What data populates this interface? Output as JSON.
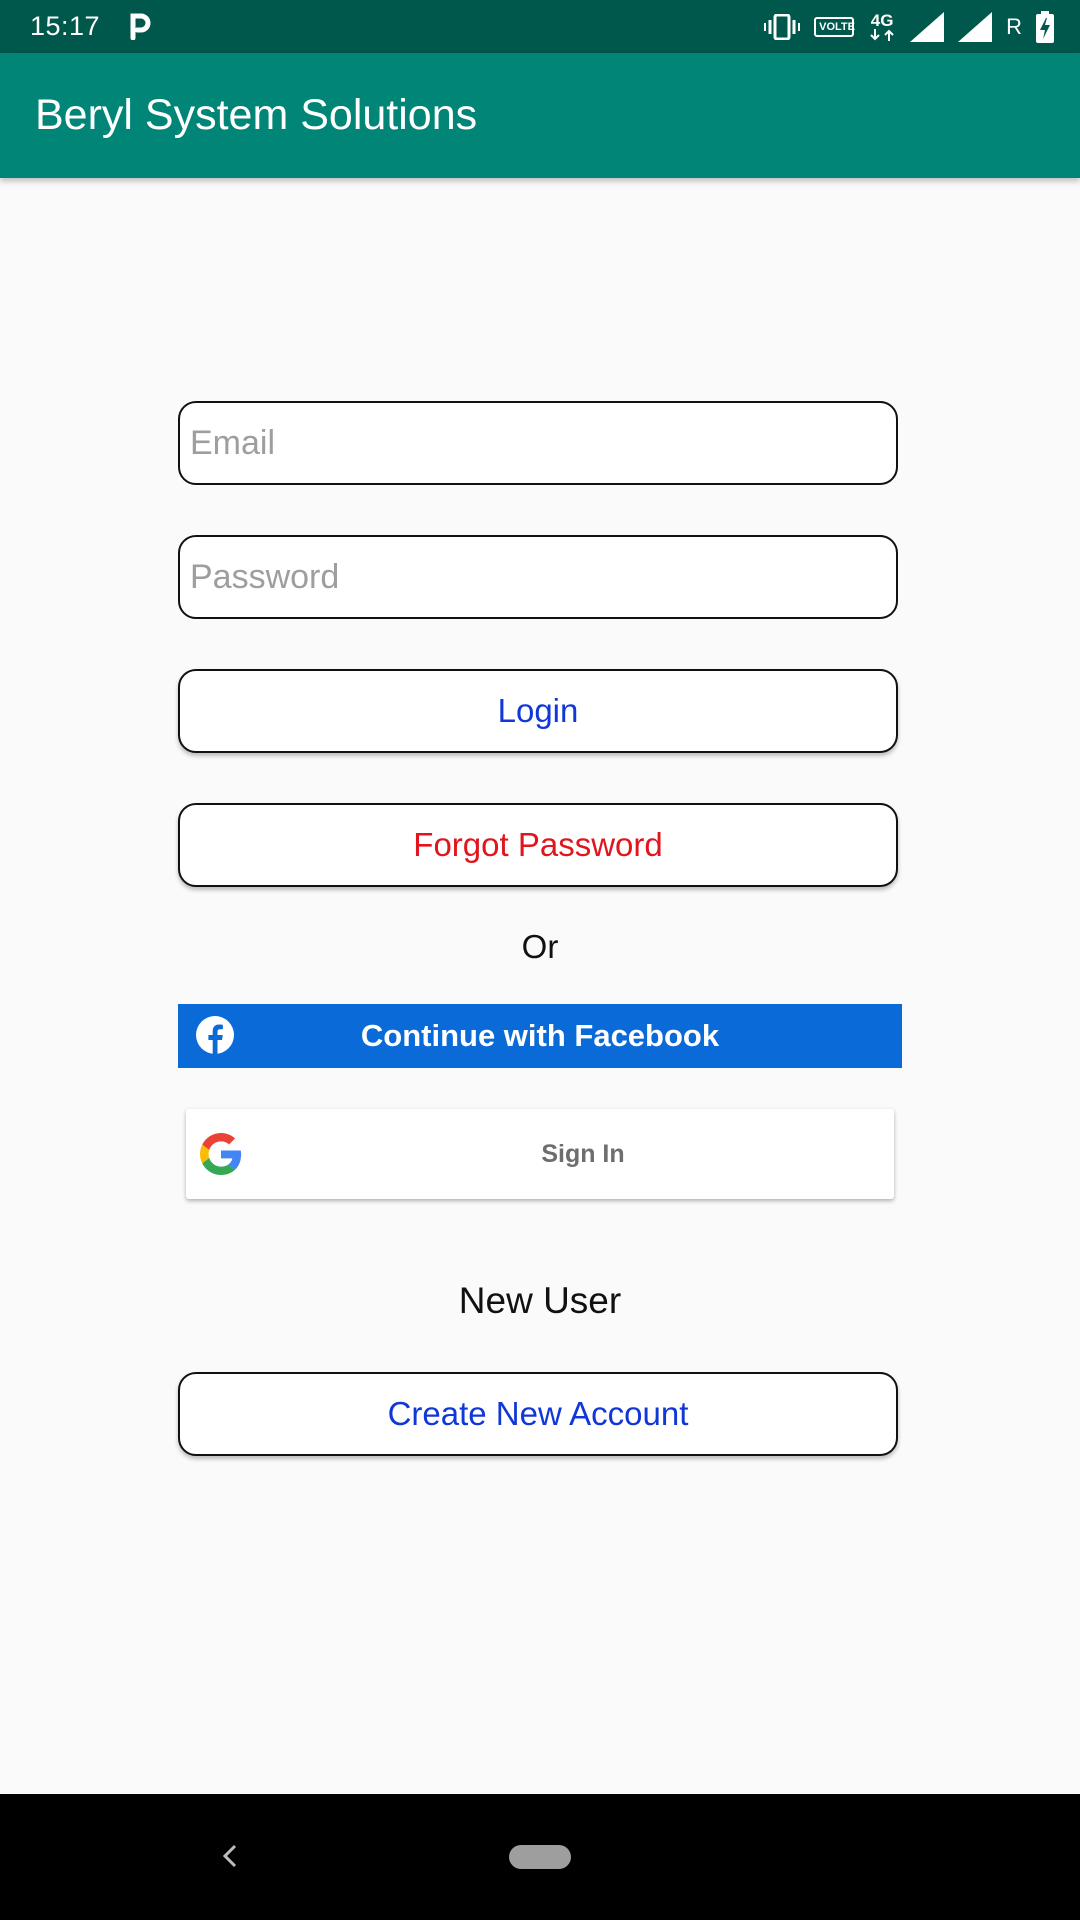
{
  "status_bar": {
    "time": "15:17",
    "volte_label": "VOLTE",
    "network_label": "4G",
    "roaming_label": "R",
    "icons": [
      "parking-icon",
      "vibrate-icon",
      "volte-icon",
      "4g-icon",
      "signal-icon",
      "signal-icon",
      "roaming-icon",
      "battery-charging-icon"
    ]
  },
  "app_bar": {
    "title": "Beryl System Solutions"
  },
  "login_form": {
    "email_placeholder": "Email",
    "email_value": "",
    "password_placeholder": "Password",
    "password_value": "",
    "login_label": "Login",
    "forgot_label": "Forgot Password",
    "or_label": "Or",
    "facebook_label": "Continue with Facebook",
    "google_label": "Sign In",
    "new_user_label": "New User",
    "create_account_label": "Create New Account"
  },
  "nav_bar": {
    "icons": [
      "back-icon",
      "home-icon"
    ]
  },
  "colors": {
    "status_bar": "#00574b",
    "app_bar": "#008577",
    "link_blue": "#1137d8",
    "forgot_red": "#e0151d",
    "facebook_blue": "#0a6ad8"
  }
}
